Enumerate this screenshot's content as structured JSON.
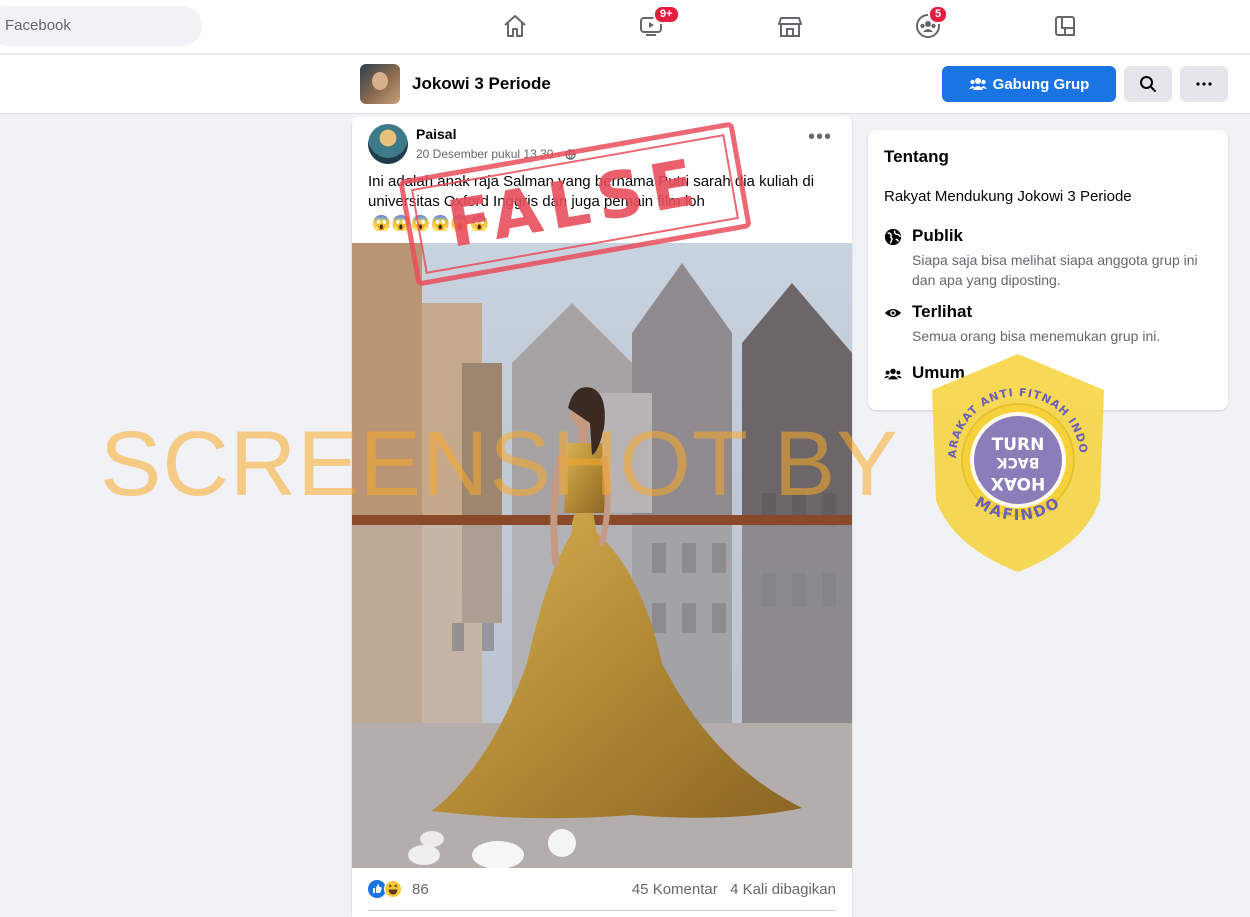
{
  "topbar": {
    "search_text": "Facebook",
    "watch_badge": "9+",
    "groups_badge": "5"
  },
  "group": {
    "name": "Jokowi 3 Periode",
    "join_label": "Gabung Grup"
  },
  "post": {
    "author": "Paisal",
    "timestamp": "20 Desember pukul 13.30",
    "separator": "·",
    "text": "Ini adalah anak raja Salman yang bernama Putri sarah dia kuliah di universitas Oxford Inggris dan juga pemain film loh",
    "emojis": "😱😱😱😱😱😱",
    "reaction_count": "86",
    "comments": "45 Komentar",
    "shares": "4 Kali dibagikan"
  },
  "about": {
    "title": "Tentang",
    "description": "Rakyat Mendukung Jokowi 3 Periode",
    "rows": [
      {
        "title": "Publik",
        "desc": "Siapa saja bisa melihat siapa anggota grup ini dan apa yang diposting.",
        "icon": "globe-icon"
      },
      {
        "title": "Terlihat",
        "desc": "Semua orang bisa menemukan grup ini.",
        "icon": "eye-icon"
      },
      {
        "title": "Umum",
        "desc": "",
        "icon": "people-icon"
      }
    ]
  },
  "overlays": {
    "stamp": "FALSE",
    "watermark": "SCREENSHOT BY",
    "seal_top": "MASYARAKAT ANTI FITNAH INDONESIA",
    "seal_bottom": "MAFINDO",
    "seal_center": [
      "TURN",
      "BACK",
      "HOAX"
    ]
  },
  "colors": {
    "primary": "#1b74e4",
    "badge": "#e41e3f",
    "stamp": "#e84e5c",
    "watermark": "#faaa28",
    "seal": "#f6d23a"
  }
}
